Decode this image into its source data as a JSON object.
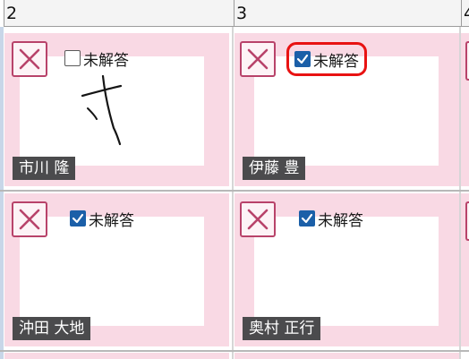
{
  "columns": [
    {
      "label": "2"
    },
    {
      "label": "3"
    },
    {
      "label": "4"
    }
  ],
  "cards": [
    {
      "student": "市川 隆",
      "unanswered_label": "未解答",
      "unanswered_checked": false,
      "has_handwriting": true,
      "highlighted": false
    },
    {
      "student": "伊藤 豊",
      "unanswered_label": "未解答",
      "unanswered_checked": true,
      "has_handwriting": false,
      "highlighted": true
    },
    {
      "student": "沖田 大地",
      "unanswered_label": "未解答",
      "unanswered_checked": true,
      "has_handwriting": false,
      "highlighted": false
    },
    {
      "student": "奥村 正行",
      "unanswered_label": "未解答",
      "unanswered_checked": true,
      "has_handwriting": false,
      "highlighted": false
    }
  ],
  "colors": {
    "card_background": "#f9d9e4",
    "mark_wrong": "#b8436a",
    "checkbox_checked": "#1b5fa8",
    "highlight_ring": "#e81212",
    "name_tag": "#4b4b4d"
  },
  "icons": {
    "wrong": "close-x-icon",
    "checked": "checkmark-icon"
  }
}
